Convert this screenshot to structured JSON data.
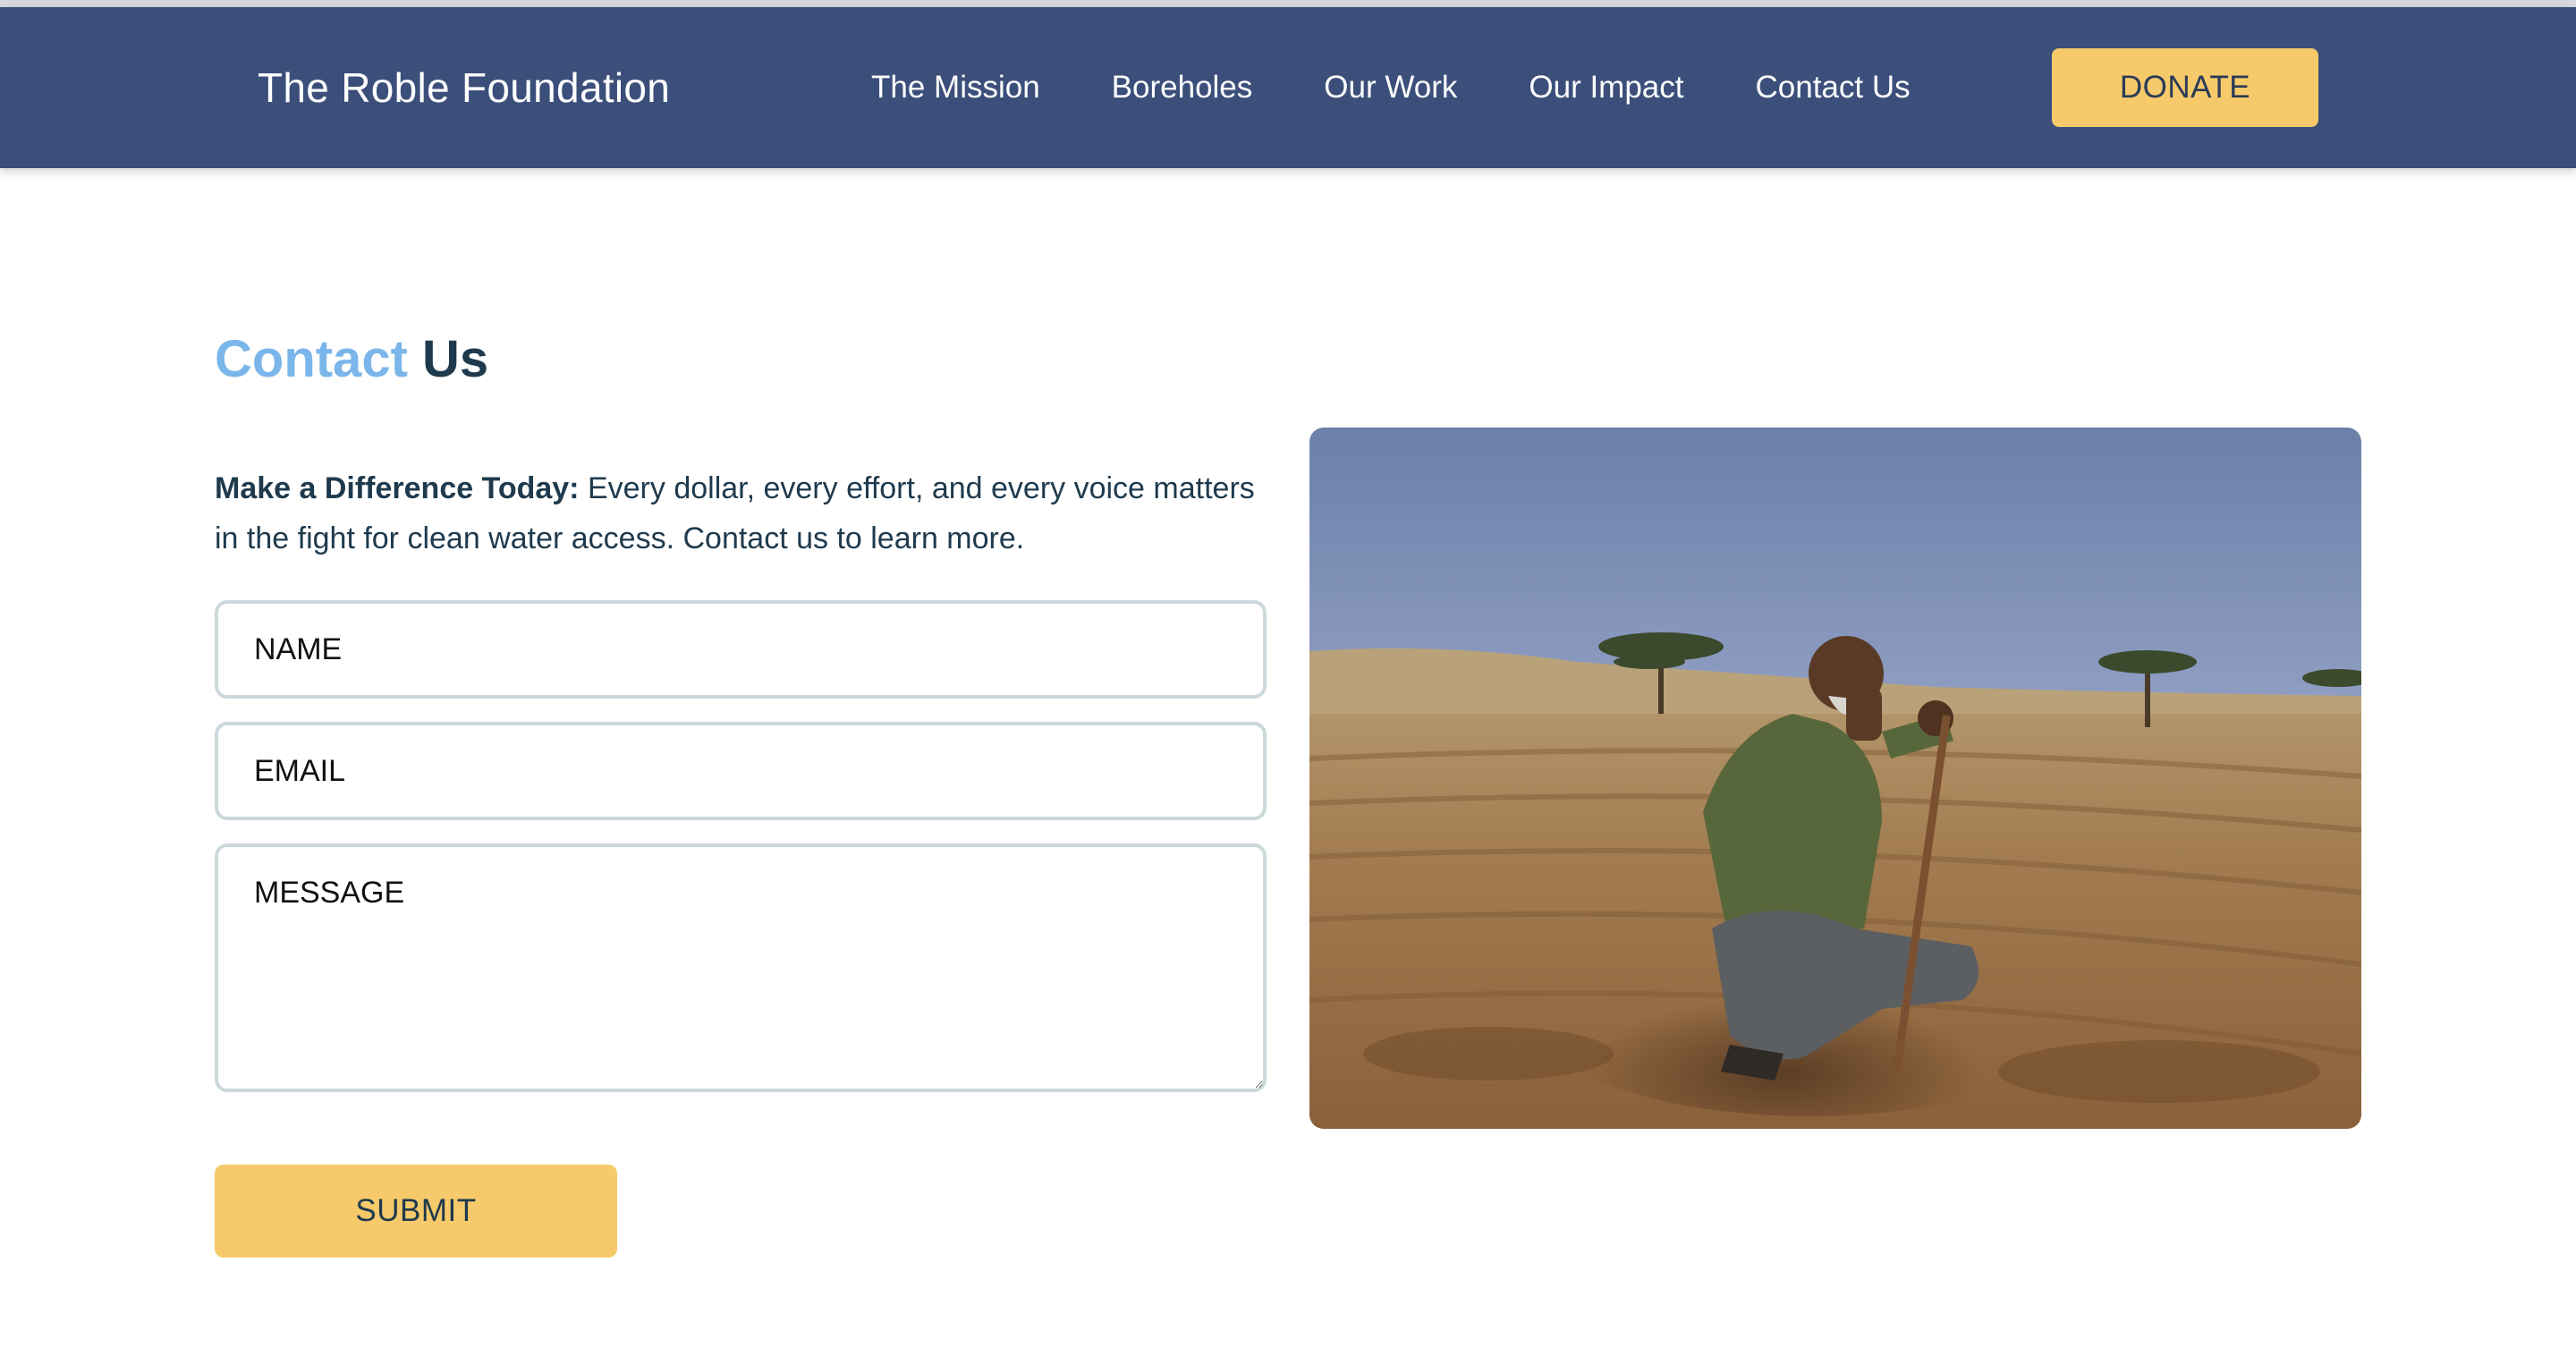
{
  "header": {
    "brand": "The Roble Foundation",
    "nav": [
      "The Mission",
      "Boreholes",
      "Our Work",
      "Our Impact",
      "Contact Us"
    ],
    "donate_label": "DONATE"
  },
  "contact": {
    "title_accent": "Contact",
    "title_rest": "Us",
    "intro_bold": "Make a Difference Today:",
    "intro_text": " Every dollar, every effort, and every voice matters in the fight for clean water access. Contact us to learn more.",
    "name_placeholder": "NAME",
    "email_placeholder": "EMAIL",
    "message_placeholder": "MESSAGE",
    "submit_label": "SUBMIT"
  },
  "colors": {
    "navbar": "#3b4f7a",
    "accent_yellow": "#f6c96a",
    "title_accent": "#7ab6ea",
    "text_dark": "#1f3a4d"
  }
}
